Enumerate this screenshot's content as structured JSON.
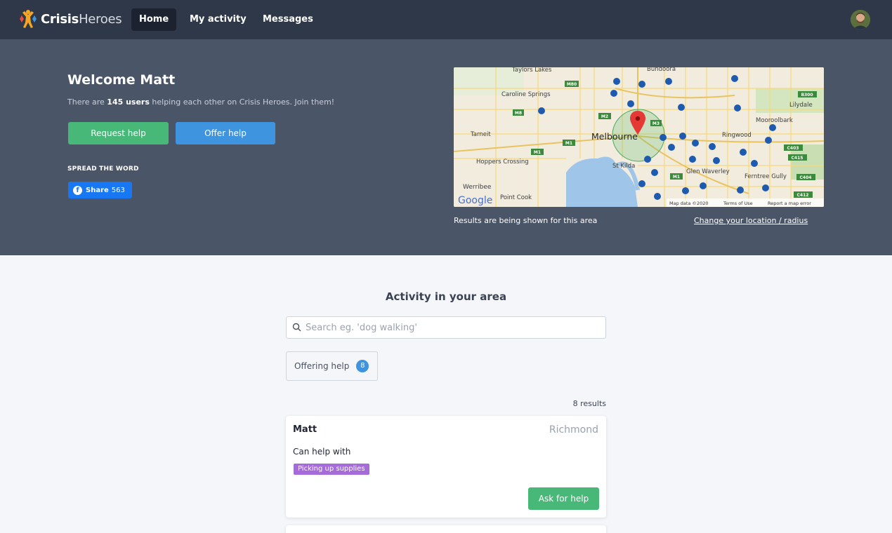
{
  "brand": {
    "name_bold": "Crisis",
    "name_light": "Heroes"
  },
  "nav": {
    "items": [
      {
        "label": "Home",
        "active": true
      },
      {
        "label": "My activity",
        "active": false
      },
      {
        "label": "Messages",
        "active": false
      }
    ]
  },
  "hero": {
    "welcome": "Welcome Matt",
    "sub_prefix": "There are ",
    "sub_count": "145 users",
    "sub_suffix": " helping each other on Crisis Heroes. Join them!",
    "request_label": "Request help",
    "offer_label": "Offer help",
    "spread_label": "SPREAD THE WORD",
    "share_label": "Share",
    "share_count": "563"
  },
  "map": {
    "places": [
      "Taylors Lakes",
      "Bundoora",
      "Caroline Springs",
      "Lilydale",
      "Mooroolbark",
      "Tarneit",
      "Melbourne",
      "Ringwood",
      "Hoppers Crossing",
      "St Kilda",
      "Glen Waverley",
      "Ferntree Gully",
      "Werribee",
      "Point Cook"
    ],
    "attribution": {
      "logo": "Google",
      "data": "Map data ©2020",
      "terms": "Terms of Use",
      "report": "Report a map error"
    },
    "note": "Results are being shown for this area",
    "change_link": "Change your location / radius"
  },
  "activity": {
    "title": "Activity in your area",
    "search_placeholder": "Search eg. 'dog walking'",
    "filter_label": "Offering help",
    "filter_count": "8",
    "results": "8 results"
  },
  "cards": [
    {
      "name": "Matt",
      "location": "Richmond",
      "sub": "Can help with",
      "tag": "Picking up supplies",
      "button": "Ask for help"
    }
  ],
  "colors": {
    "nav_bg": "#2f3848",
    "hero_bg": "#4b5568",
    "green": "#48b878",
    "blue": "#3f94e0",
    "tag_purple": "#a56bd9"
  }
}
